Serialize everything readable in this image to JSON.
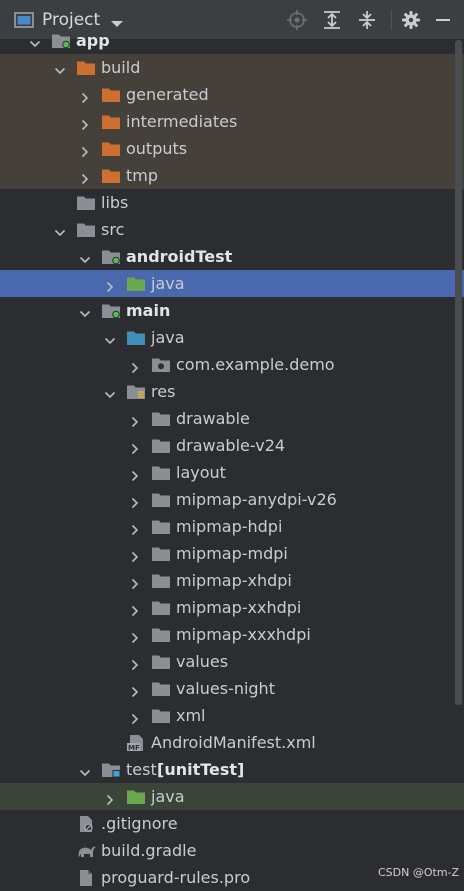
{
  "header": {
    "title": "Project",
    "tools": [
      {
        "name": "locate-icon"
      },
      {
        "name": "expand-all-icon"
      },
      {
        "name": "collapse-all-icon"
      },
      {
        "name": "gear-icon"
      },
      {
        "name": "minimize-icon"
      }
    ]
  },
  "tree": [
    {
      "label": "app",
      "indent": 0,
      "chevron": "down",
      "icon": "module",
      "bold": true
    },
    {
      "label": "build",
      "indent": 1,
      "chevron": "down",
      "icon": "folder-orange",
      "band": true
    },
    {
      "label": "generated",
      "indent": 2,
      "chevron": "right",
      "icon": "folder-orange",
      "band": true
    },
    {
      "label": "intermediates",
      "indent": 2,
      "chevron": "right",
      "icon": "folder-orange",
      "band": true
    },
    {
      "label": "outputs",
      "indent": 2,
      "chevron": "right",
      "icon": "folder-orange",
      "band": true
    },
    {
      "label": "tmp",
      "indent": 2,
      "chevron": "right",
      "icon": "folder-orange",
      "band": true
    },
    {
      "label": "libs",
      "indent": 1,
      "chevron": "none",
      "icon": "folder-gray"
    },
    {
      "label": "src",
      "indent": 1,
      "chevron": "down",
      "icon": "folder-gray"
    },
    {
      "label": "androidTest",
      "indent": 2,
      "chevron": "down",
      "icon": "folder-module-green",
      "bold": true
    },
    {
      "label": "java",
      "indent": 3,
      "chevron": "right",
      "icon": "folder-green",
      "selected": true
    },
    {
      "label": "main",
      "indent": 2,
      "chevron": "down",
      "icon": "folder-module-green",
      "bold": true
    },
    {
      "label": "java",
      "indent": 3,
      "chevron": "down",
      "icon": "folder-blue"
    },
    {
      "label": "com.example.demo",
      "indent": 4,
      "chevron": "right",
      "icon": "package"
    },
    {
      "label": "res",
      "indent": 3,
      "chevron": "down",
      "icon": "folder-res"
    },
    {
      "label": "drawable",
      "indent": 4,
      "chevron": "right",
      "icon": "folder-gray"
    },
    {
      "label": "drawable-v24",
      "indent": 4,
      "chevron": "right",
      "icon": "folder-gray"
    },
    {
      "label": "layout",
      "indent": 4,
      "chevron": "right",
      "icon": "folder-gray"
    },
    {
      "label": "mipmap-anydpi-v26",
      "indent": 4,
      "chevron": "right",
      "icon": "folder-gray"
    },
    {
      "label": "mipmap-hdpi",
      "indent": 4,
      "chevron": "right",
      "icon": "folder-gray"
    },
    {
      "label": "mipmap-mdpi",
      "indent": 4,
      "chevron": "right",
      "icon": "folder-gray"
    },
    {
      "label": "mipmap-xhdpi",
      "indent": 4,
      "chevron": "right",
      "icon": "folder-gray"
    },
    {
      "label": "mipmap-xxhdpi",
      "indent": 4,
      "chevron": "right",
      "icon": "folder-gray"
    },
    {
      "label": "mipmap-xxxhdpi",
      "indent": 4,
      "chevron": "right",
      "icon": "folder-gray"
    },
    {
      "label": "values",
      "indent": 4,
      "chevron": "right",
      "icon": "folder-gray"
    },
    {
      "label": "values-night",
      "indent": 4,
      "chevron": "right",
      "icon": "folder-gray"
    },
    {
      "label": "xml",
      "indent": 4,
      "chevron": "right",
      "icon": "folder-gray"
    },
    {
      "label": "AndroidManifest.xml",
      "indent": 3,
      "chevron": "none",
      "icon": "manifest"
    },
    {
      "label": "test",
      "label_extra": " [unitTest]",
      "indent": 2,
      "chevron": "down",
      "icon": "folder-module-blue"
    },
    {
      "label": "java",
      "indent": 3,
      "chevron": "right",
      "icon": "folder-green",
      "green": true
    },
    {
      "label": ".gitignore",
      "indent": 1,
      "chevron": "none",
      "icon": "file-gitignore"
    },
    {
      "label": "build.gradle",
      "indent": 1,
      "chevron": "none",
      "icon": "gradle"
    },
    {
      "label": "proguard-rules.pro",
      "indent": 1,
      "chevron": "none",
      "icon": "file-generic"
    }
  ],
  "watermark": "CSDN @Otm-Z",
  "colors": {
    "background": "#2b2d30",
    "header": "#3c3f41",
    "build_band": "#45413a",
    "selection": "#4a68ad",
    "green_band": "#3a4438",
    "folder_orange": "#cc6f2f",
    "folder_gray": "#8a8f96",
    "folder_green": "#6aa84f",
    "folder_blue": "#3f8fb8"
  }
}
